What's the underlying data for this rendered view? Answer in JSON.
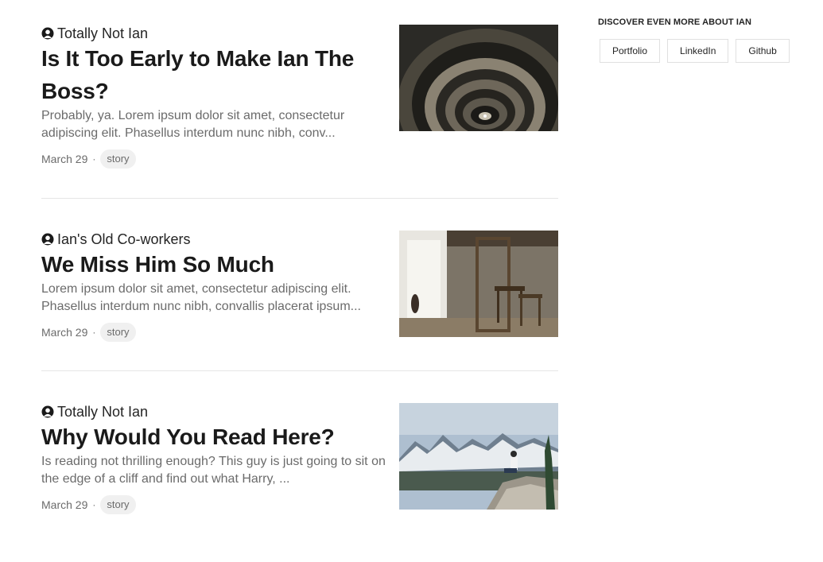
{
  "articles": [
    {
      "author": "Totally Not Ian",
      "title": "Is It Too Early to Make Ian The Boss?",
      "excerpt": "Probably, ya. Lorem ipsum dolor sit amet, consectetur adipiscing elit. Phasellus interdum nunc nibh, conv...",
      "date": "March 29",
      "separator": "·",
      "tag": "story",
      "image_icon": "spiral-staircase-image"
    },
    {
      "author": "Ian's Old Co-workers",
      "title": "We Miss Him So Much",
      "excerpt": "Lorem ipsum dolor sit amet, consectetur adipiscing elit. Phasellus interdum nunc nibh, convallis placerat ipsum...",
      "date": "March 29",
      "separator": "·",
      "tag": "story",
      "image_icon": "empty-room-image"
    },
    {
      "author": "Totally Not Ian",
      "title": "Why Would You Read Here?",
      "excerpt": "Is reading not thrilling enough? This guy is just going to sit on the edge of a cliff and find out what Harry, ...",
      "date": "March 29",
      "separator": "·",
      "tag": "story",
      "image_icon": "mountain-cliff-image"
    }
  ],
  "sidebar": {
    "title": "DISCOVER EVEN MORE ABOUT IAN",
    "links": [
      "Portfolio",
      "LinkedIn",
      "Github"
    ]
  }
}
